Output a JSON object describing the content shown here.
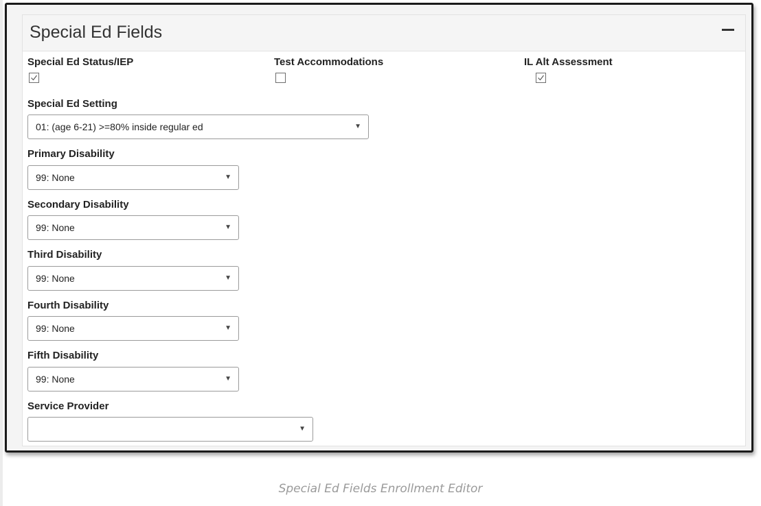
{
  "panel": {
    "title": "Special Ed Fields",
    "collapse_icon": "minus-icon"
  },
  "checkboxes": [
    {
      "label": "Special Ed Status/IEP",
      "checked": true
    },
    {
      "label": "Test Accommodations",
      "checked": false
    },
    {
      "label": "IL Alt Assessment",
      "checked": true
    }
  ],
  "selects": [
    {
      "label": "Special Ed Setting",
      "value": "01: (age 6-21) >=80% inside regular ed"
    },
    {
      "label": "Primary Disability",
      "value": "99: None"
    },
    {
      "label": "Secondary Disability",
      "value": "99: None"
    },
    {
      "label": "Third Disability",
      "value": "99: None"
    },
    {
      "label": "Fourth Disability",
      "value": "99: None"
    },
    {
      "label": "Fifth Disability",
      "value": "99: None"
    },
    {
      "label": "Service Provider",
      "value": ""
    }
  ],
  "caption": "Special Ed Fields Enrollment Editor"
}
